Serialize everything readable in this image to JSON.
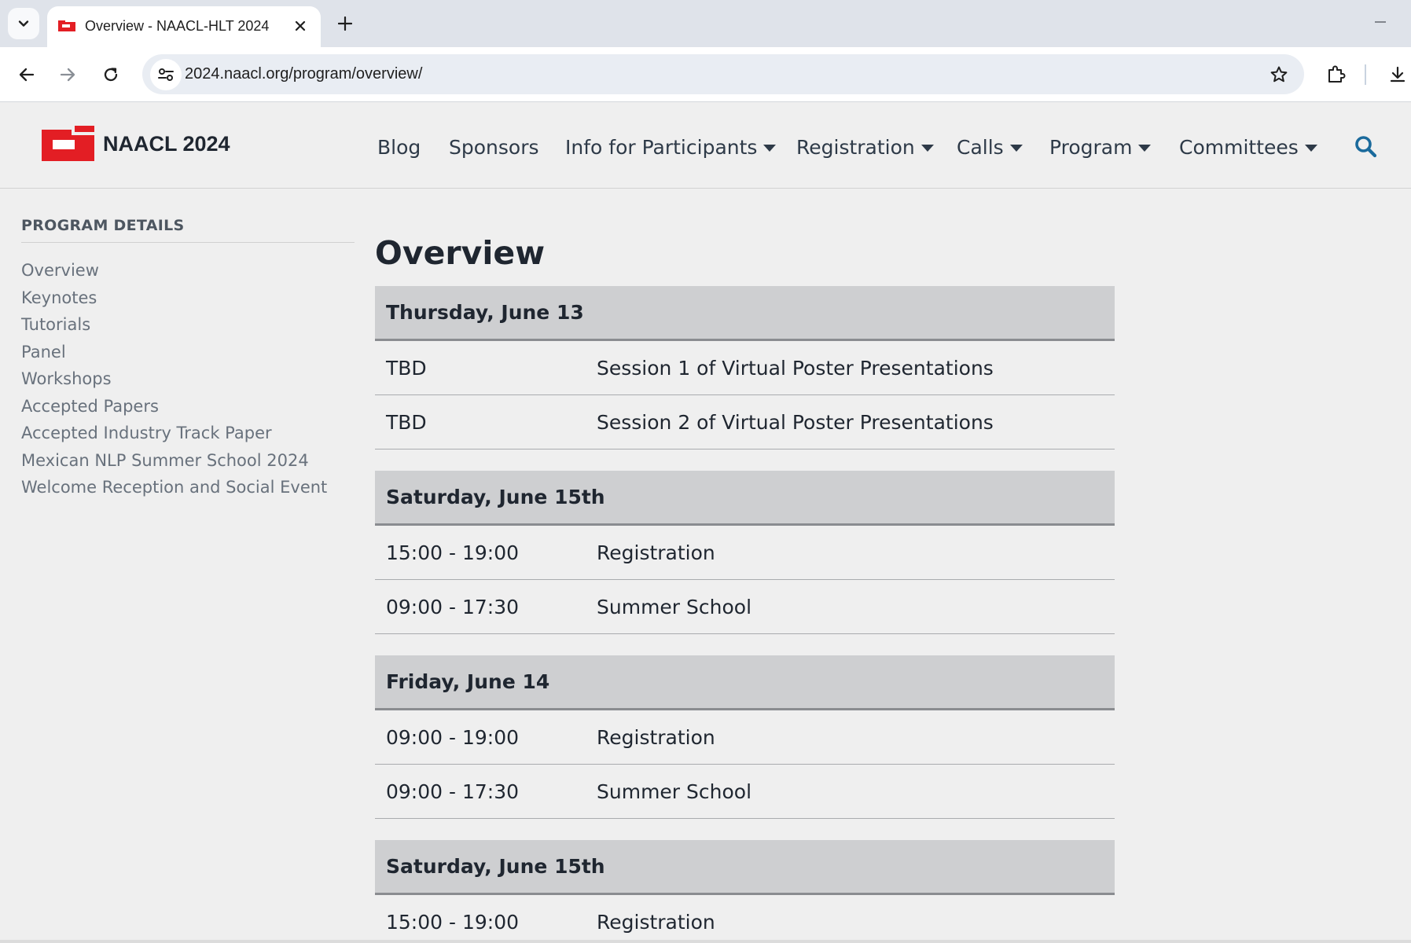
{
  "browser": {
    "tab_title": "Overview - NAACL-HLT 2024",
    "url": "2024.naacl.org/program/overview/"
  },
  "site": {
    "logo_text": "NAACL 2024",
    "brand_color": "#e31e24",
    "nav": [
      {
        "label": "Blog",
        "dropdown": false
      },
      {
        "label": "Sponsors",
        "dropdown": false
      },
      {
        "label": "Info for Participants",
        "dropdown": true
      },
      {
        "label": "Registration",
        "dropdown": true
      },
      {
        "label": "Calls",
        "dropdown": true
      },
      {
        "label": "Program",
        "dropdown": true
      },
      {
        "label": "Committees",
        "dropdown": true
      }
    ],
    "search_icon_color": "#1a6a9c"
  },
  "sidebar": {
    "heading": "PROGRAM DETAILS",
    "items": [
      "Overview",
      "Keynotes",
      "Tutorials",
      "Panel",
      "Workshops",
      "Accepted Papers",
      "Accepted Industry Track Paper",
      "Mexican NLP Summer School 2024",
      "Welcome Reception and Social Event"
    ]
  },
  "main": {
    "title": "Overview",
    "days": [
      {
        "day": "Thursday, June 13",
        "rows": [
          {
            "time": "TBD",
            "event": "Session 1 of Virtual Poster Presentations"
          },
          {
            "time": "TBD",
            "event": "Session 2 of Virtual Poster Presentations"
          }
        ]
      },
      {
        "day": "Saturday, June 15th",
        "rows": [
          {
            "time": "15:00 - 19:00",
            "event": "Registration"
          },
          {
            "time": "09:00 - 17:30",
            "event": "Summer School"
          }
        ]
      },
      {
        "day": "Friday, June 14",
        "rows": [
          {
            "time": "09:00 - 19:00",
            "event": "Registration"
          },
          {
            "time": "09:00 - 17:30",
            "event": "Summer School"
          }
        ]
      },
      {
        "day": "Saturday, June 15th",
        "rows": [
          {
            "time": "15:00 - 19:00",
            "event": "Registration"
          }
        ]
      }
    ]
  }
}
